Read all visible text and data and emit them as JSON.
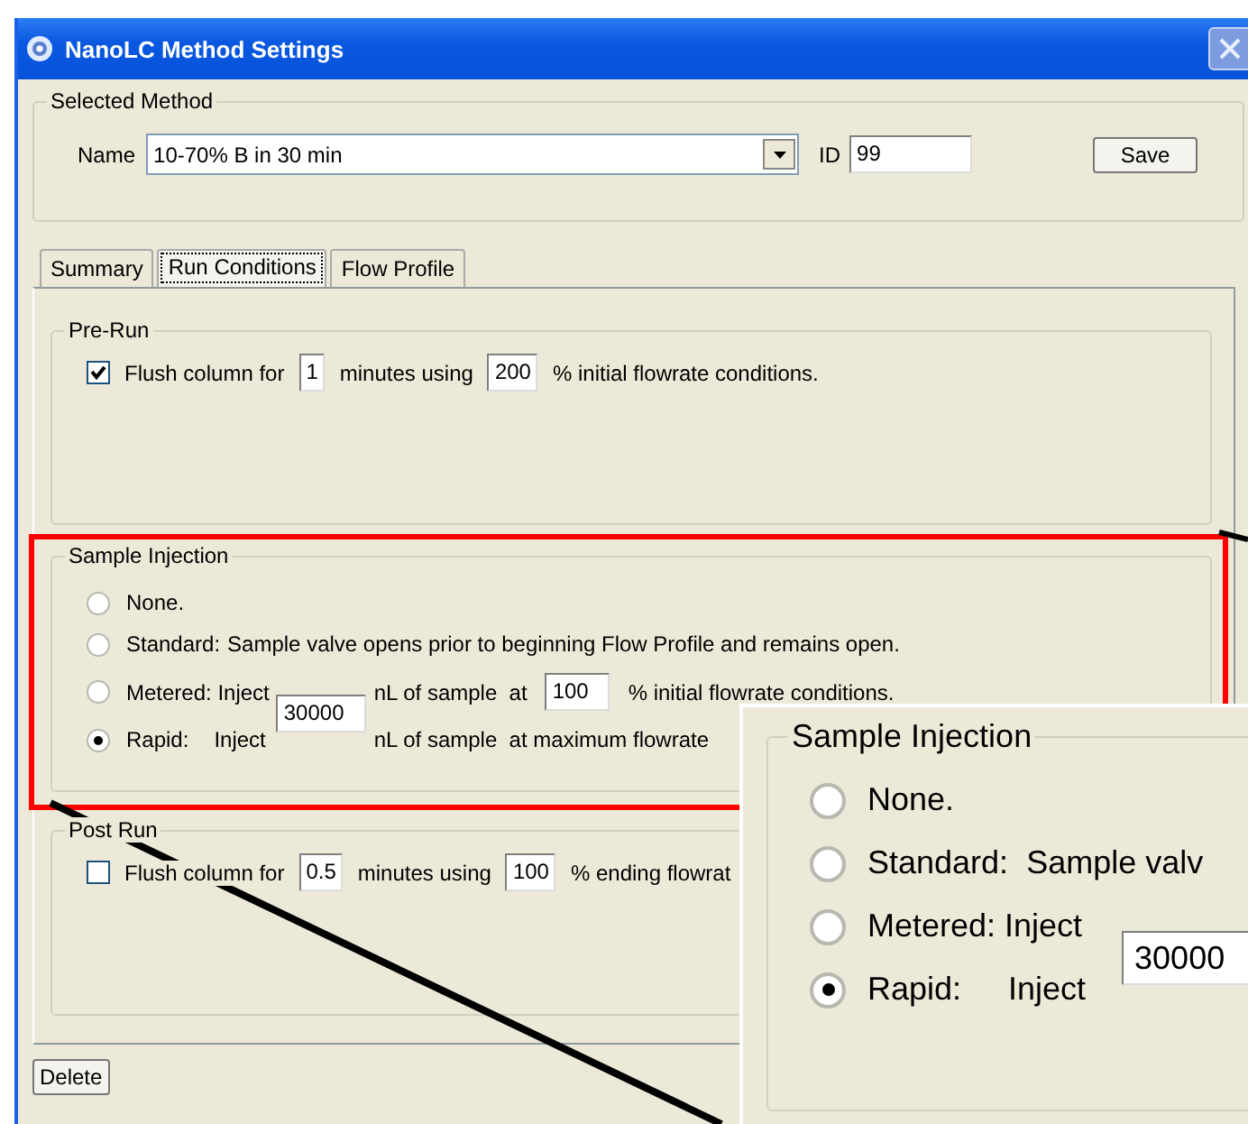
{
  "window": {
    "title": "NanoLC Method Settings"
  },
  "selected_method": {
    "legend": "Selected Method",
    "name_label": "Name",
    "name_value": "10-70% B in 30 min",
    "id_label": "ID",
    "id_value": "99",
    "save_button": "Save"
  },
  "tabs": [
    {
      "label": "Summary",
      "selected": false
    },
    {
      "label": "Run Conditions",
      "selected": true
    },
    {
      "label": "Flow Profile",
      "selected": false
    }
  ],
  "pre_run": {
    "legend": "Pre-Run",
    "checked": true,
    "parts": [
      {
        "kind": "text",
        "text": "Flush column for"
      },
      {
        "kind": "field",
        "value": "1"
      },
      {
        "kind": "text",
        "text": "minutes using"
      },
      {
        "kind": "field",
        "value": "200"
      },
      {
        "kind": "text",
        "text": "% initial flowrate conditions."
      }
    ]
  },
  "sample_injection": {
    "legend": "Sample Injection",
    "volume_field": "30000",
    "options": [
      {
        "label": "None.",
        "selected": false
      },
      {
        "label": "Standard:",
        "selected": false,
        "parts": [
          {
            "kind": "text",
            "text": "Sample valve opens prior to beginning Flow Profile and remains open."
          }
        ]
      },
      {
        "label": "Metered: Inject",
        "selected": false,
        "parts": [
          {
            "kind": "text",
            "text": "nL of sample  at"
          },
          {
            "kind": "field",
            "value": "100"
          },
          {
            "kind": "text",
            "text": "% initial flowrate conditions."
          }
        ]
      },
      {
        "label": "Rapid:",
        "word": "Inject",
        "selected": true,
        "parts": [
          {
            "kind": "text",
            "text": "nL of sample  at maximum flowrate"
          }
        ]
      }
    ]
  },
  "post_run": {
    "legend": "Post Run",
    "checked": false,
    "parts": [
      {
        "kind": "text",
        "text": "Flush column for"
      },
      {
        "kind": "field",
        "value": "0.5"
      },
      {
        "kind": "text",
        "text": "minutes using"
      },
      {
        "kind": "field",
        "value": "100"
      },
      {
        "kind": "text",
        "text": "% ending flowrat"
      }
    ]
  },
  "delete_button": "Delete",
  "zoom_inset": {
    "legend": "Sample Injection",
    "volume_field": "30000",
    "options": [
      {
        "label": "None.",
        "selected": false
      },
      {
        "label": "Standard:",
        "word": "Sample valv",
        "selected": false
      },
      {
        "label": "Metered: Inject",
        "selected": false
      },
      {
        "label": "Rapid:",
        "word": "Inject",
        "selected": true
      }
    ]
  }
}
